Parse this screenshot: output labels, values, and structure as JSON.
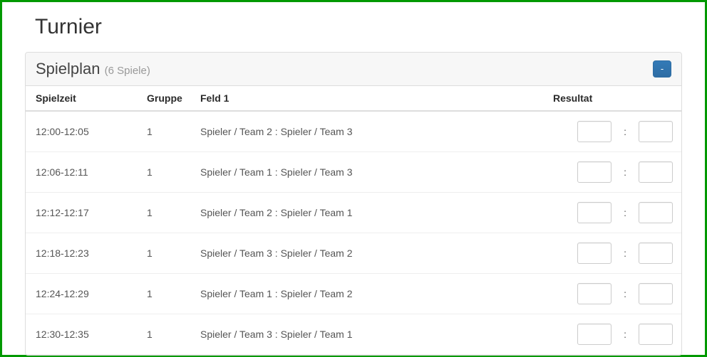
{
  "page_title": "Turnier",
  "panel": {
    "title": "Spielplan",
    "count_label": "(6 Spiele)",
    "collapse_label": "-"
  },
  "headers": {
    "time": "Spielzeit",
    "group": "Gruppe",
    "field": "Feld 1",
    "result": "Resultat"
  },
  "colon": ":",
  "rows": [
    {
      "time": "12:00-12:05",
      "group": "1",
      "match": "Spieler / Team 2 : Spieler / Team 3",
      "score_a": "",
      "score_b": ""
    },
    {
      "time": "12:06-12:11",
      "group": "1",
      "match": "Spieler / Team 1 : Spieler / Team 3",
      "score_a": "",
      "score_b": ""
    },
    {
      "time": "12:12-12:17",
      "group": "1",
      "match": "Spieler / Team 2 : Spieler / Team 1",
      "score_a": "",
      "score_b": ""
    },
    {
      "time": "12:18-12:23",
      "group": "1",
      "match": "Spieler / Team 3 : Spieler / Team 2",
      "score_a": "",
      "score_b": ""
    },
    {
      "time": "12:24-12:29",
      "group": "1",
      "match": "Spieler / Team 1 : Spieler / Team 2",
      "score_a": "",
      "score_b": ""
    },
    {
      "time": "12:30-12:35",
      "group": "1",
      "match": "Spieler / Team 3 : Spieler / Team 1",
      "score_a": "",
      "score_b": ""
    }
  ]
}
